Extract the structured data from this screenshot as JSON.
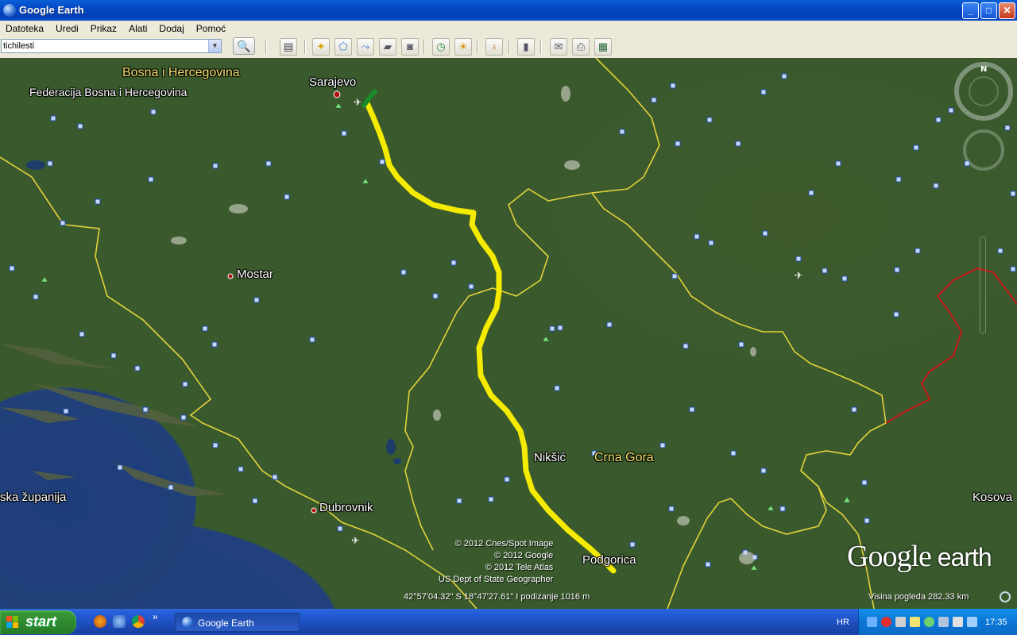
{
  "window": {
    "title": "Google Earth",
    "controls": {
      "minimize": "_",
      "maximize": "□",
      "close": "✕"
    }
  },
  "menu": [
    "Datoteka",
    "Uredi",
    "Prikaz",
    "Alati",
    "Dodaj",
    "Pomoć"
  ],
  "search": {
    "value": "tichilesti"
  },
  "map": {
    "labels": {
      "bosnia": "Bosna i Hercegovina",
      "federation": "Federacija Bosna i Hercegovina",
      "sarajevo": "Sarajevo",
      "mostar": "Mostar",
      "dubrovnik": "Dubrovnik",
      "niksic": "Nikšić",
      "crna_gora": "Crna Gora",
      "podgorica": "Podgorica",
      "kosova": "Kosova",
      "zupanija": "ska županija"
    },
    "copyright": [
      "© 2012 Cnes/Spot Image",
      "© 2012 Google",
      "© 2012 Tele Atlas",
      "US Dept of State Geographer"
    ],
    "status": "42°57'04.32\" S 18°47'27.61\" I podizanje 1016 m",
    "eye_altitude": "Visina pogleda 282.33 km",
    "logo": {
      "main": "Google",
      "sub": " earth"
    },
    "compass_north": "N"
  },
  "taskbar": {
    "start": "start",
    "task": "Google Earth",
    "lang": "HR",
    "clock": "17:35",
    "more": "»"
  },
  "colors": {
    "route": "#f5eb00",
    "route_start": "#1c8a2a",
    "border": "#e3d23a",
    "border_red": "#c81818"
  }
}
